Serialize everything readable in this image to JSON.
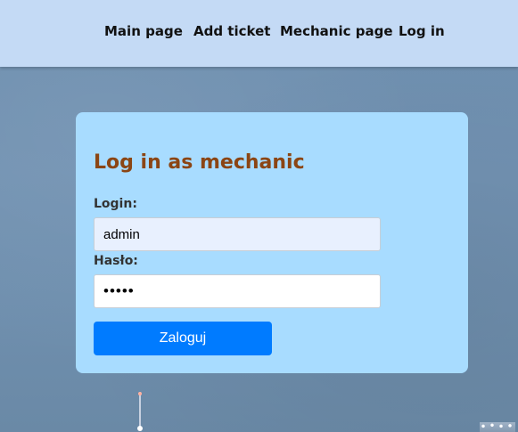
{
  "nav": {
    "items": [
      {
        "label": "Main page"
      },
      {
        "label": "Add ticket"
      },
      {
        "label": "Mechanic page"
      },
      {
        "label": "Log in"
      }
    ]
  },
  "login_form": {
    "title": "Log in as mechanic",
    "login_label": "Login:",
    "login_value": "admin",
    "password_label": "Hasło:",
    "password_value": "•••••",
    "submit_label": "Zaloguj"
  },
  "colors": {
    "navbar_bg": "#c4daf5",
    "card_bg": "#a8dcff",
    "title_color": "#8b4513",
    "button_bg": "#007bff",
    "button_text": "#ffffff"
  }
}
